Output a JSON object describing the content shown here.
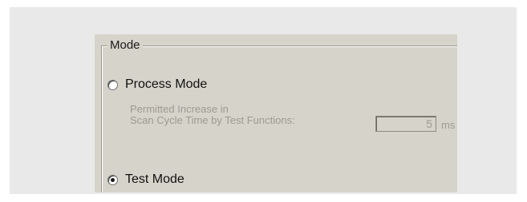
{
  "group": {
    "title": "Mode"
  },
  "options": {
    "process_mode": {
      "label": "Process Mode",
      "selected": false
    },
    "test_mode": {
      "label": "Test Mode",
      "selected": true
    }
  },
  "scan_cycle": {
    "label_line1": "Permitted Increase in",
    "label_line2": "Scan Cycle Time by Test Functions:",
    "value": "5",
    "unit": "ms"
  }
}
